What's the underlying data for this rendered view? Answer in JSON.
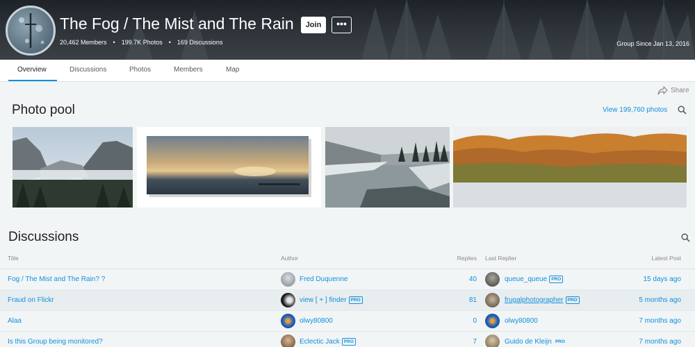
{
  "group": {
    "title": "The Fog / The Mist and The Rain",
    "join_label": "Join",
    "more_label": "•••",
    "members": "20,462 Members",
    "photos": "199.7K Photos",
    "discussions": "169 Discussions",
    "since": "Group Since Jan 13, 2016"
  },
  "tabs": [
    "Overview",
    "Discussions",
    "Photos",
    "Members",
    "Map"
  ],
  "share_label": "Share",
  "photo_pool": {
    "title": "Photo pool",
    "view_link": "View 199,760 photos"
  },
  "discussions": {
    "title": "Discussions",
    "columns": {
      "title": "Title",
      "author": "Author",
      "replies": "Replies",
      "last_replier": "Last Replier",
      "latest_post": "Latest Post"
    },
    "pro_label": "PRO",
    "rows": [
      {
        "title": "Fog / The Mist and The Rain? ?",
        "author": "Fred Duquenne",
        "replies": "40",
        "last_replier": "queue_queue",
        "latest": "15 days ago"
      },
      {
        "title": "Fraud on Flickr",
        "author": "view [ + ] finder",
        "replies": "81",
        "last_replier": "frugalphotographer",
        "latest": "5 months ago"
      },
      {
        "title": "Alaa",
        "author": "olwy80800",
        "replies": "0",
        "last_replier": "olwy80800",
        "latest": "7 months ago"
      },
      {
        "title": "Is this Group being monitored?",
        "author": "Eclectic Jack",
        "replies": "7",
        "last_replier": "Guido de Kleijn",
        "latest": "7 months ago"
      }
    ]
  },
  "colors": {
    "accent": "#128fdc",
    "header_bg": "#2c3238",
    "page_bg": "#f2f5f6"
  }
}
